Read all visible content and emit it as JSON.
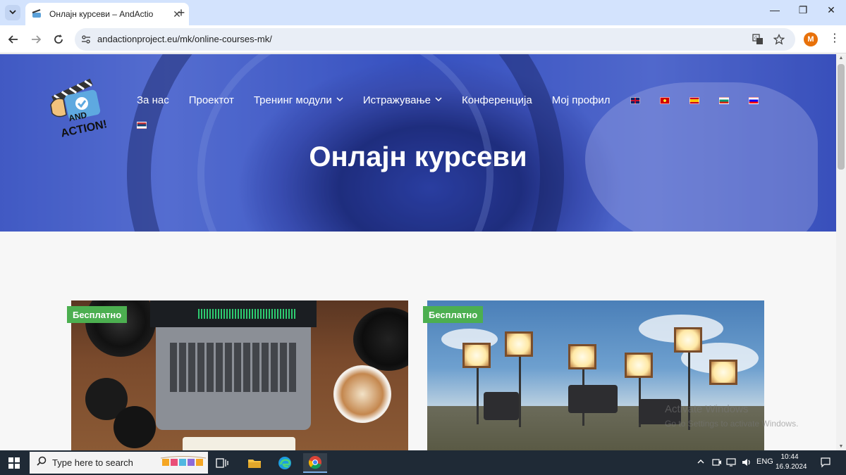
{
  "browser": {
    "tab_title": "Онлајн курсеви – AndAction P",
    "url": "andactionproject.eu/mk/online-courses-mk/",
    "profile_initial": "M",
    "tab_close": "✕",
    "new_tab": "+",
    "minimize": "—",
    "restore": "❐",
    "close": "✕",
    "menu": "⋮"
  },
  "site": {
    "nav": [
      {
        "label": "За нас",
        "dropdown": false
      },
      {
        "label": "Проектот",
        "dropdown": false
      },
      {
        "label": "Тренинг модули",
        "dropdown": true
      },
      {
        "label": "Истражување",
        "dropdown": true
      },
      {
        "label": "Конференција",
        "dropdown": false
      },
      {
        "label": "Мој профил",
        "dropdown": false
      }
    ],
    "languages": [
      "en-flag-icon",
      "mk-flag-icon",
      "es-flag-icon",
      "bg-flag-icon",
      "si-flag-icon",
      "rs-flag-icon"
    ],
    "page_title": "Онлајн курсеви",
    "cards": [
      {
        "badge": "Бесплатно"
      },
      {
        "badge": "Бесплатно"
      }
    ],
    "badge_color": "#4caf50"
  },
  "watermark": {
    "line1": "Activate Windows",
    "line2": "Go to Settings to activate Windows."
  },
  "taskbar": {
    "search_placeholder": "Type here to search",
    "language": "ENG",
    "time": "10:44",
    "date": "16.9.2024"
  }
}
